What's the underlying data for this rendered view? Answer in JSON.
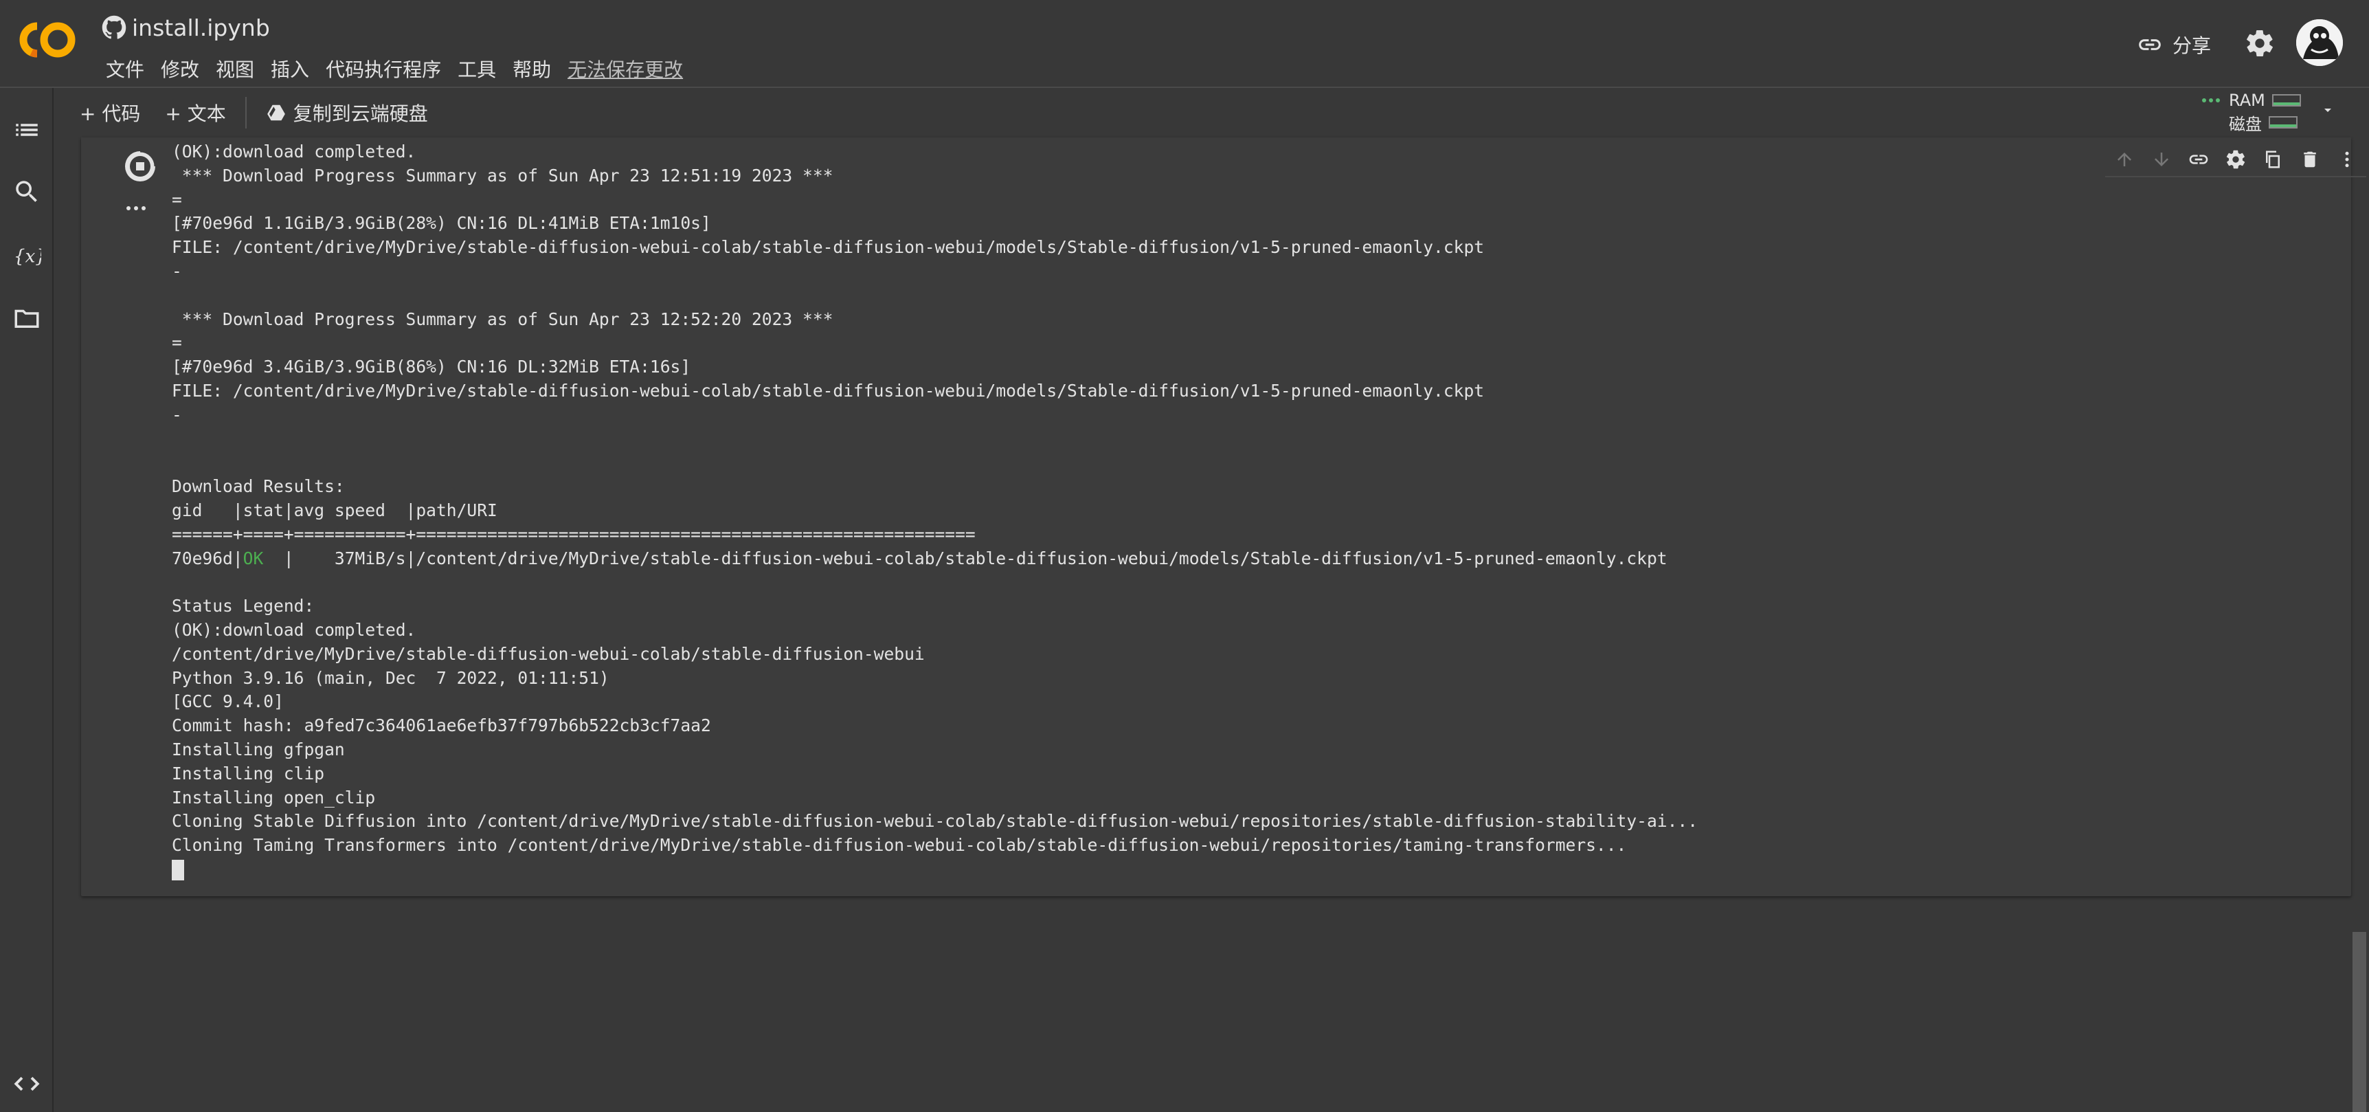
{
  "header": {
    "title": "install.ipynb",
    "menu": [
      "文件",
      "修改",
      "视图",
      "插入",
      "代码执行程序",
      "工具",
      "帮助"
    ],
    "unsaved_label": "无法保存更改",
    "share_label": "分享"
  },
  "toolbar": {
    "add_code_label": "+ 代码",
    "add_text_label": "+ 文本",
    "copy_to_drive_label": "复制到云端硬盘",
    "ram_label": "RAM",
    "disk_label": "磁盘"
  },
  "output": {
    "lines": [
      "(OK):download completed.",
      " *** Download Progress Summary as of Sun Apr 23 12:51:19 2023 ***",
      "=",
      "[#70e96d 1.1GiB/3.9GiB(28%) CN:16 DL:41MiB ETA:1m10s]",
      "FILE: /content/drive/MyDrive/stable-diffusion-webui-colab/stable-diffusion-webui/models/Stable-diffusion/v1-5-pruned-emaonly.ckpt",
      "-",
      "",
      " *** Download Progress Summary as of Sun Apr 23 12:52:20 2023 ***",
      "=",
      "[#70e96d 3.4GiB/3.9GiB(86%) CN:16 DL:32MiB ETA:16s]",
      "FILE: /content/drive/MyDrive/stable-diffusion-webui-colab/stable-diffusion-webui/models/Stable-diffusion/v1-5-pruned-emaonly.ckpt",
      "-",
      "",
      "",
      "Download Results:",
      "gid   |stat|avg speed  |path/URI",
      "======+====+===========+=======================================================",
      "RESULT_ROW",
      "",
      "Status Legend:",
      "(OK):download completed.",
      "/content/drive/MyDrive/stable-diffusion-webui-colab/stable-diffusion-webui",
      "Python 3.9.16 (main, Dec  7 2022, 01:11:51)",
      "[GCC 9.4.0]",
      "Commit hash: a9fed7c364061ae6efb37f797b6b522cb3cf7aa2",
      "Installing gfpgan",
      "Installing clip",
      "Installing open_clip",
      "Cloning Stable Diffusion into /content/drive/MyDrive/stable-diffusion-webui-colab/stable-diffusion-webui/repositories/stable-diffusion-stability-ai...",
      "Cloning Taming Transformers into /content/drive/MyDrive/stable-diffusion-webui-colab/stable-diffusion-webui/repositories/taming-transformers...",
      "CURSOR"
    ],
    "result_row": {
      "gid": "70e96d|",
      "stat": "OK",
      "rest": "  |    37MiB/s|/content/drive/MyDrive/stable-diffusion-webui-colab/stable-diffusion-webui/models/Stable-diffusion/v1-5-pruned-emaonly.ckpt"
    }
  },
  "colors": {
    "background": "#383838",
    "cell": "#3c3c3c",
    "ok_status": "#4caf50",
    "logo_orange": "#f9ab00",
    "logo_dark_orange": "#e8710a",
    "ram_indicator": "#5bb974"
  },
  "icons": [
    "colab-logo",
    "github-icon",
    "link-icon",
    "gear-icon",
    "avatar",
    "table-of-contents-icon",
    "search-icon",
    "variables-icon",
    "folder-icon",
    "code-snippets-icon",
    "drive-icon",
    "chevron-down-icon",
    "chevron-up-icon",
    "stop-icon",
    "more-horiz-icon",
    "arrow-up-icon",
    "arrow-down-icon",
    "copy-icon",
    "delete-icon",
    "more-vert-icon"
  ]
}
